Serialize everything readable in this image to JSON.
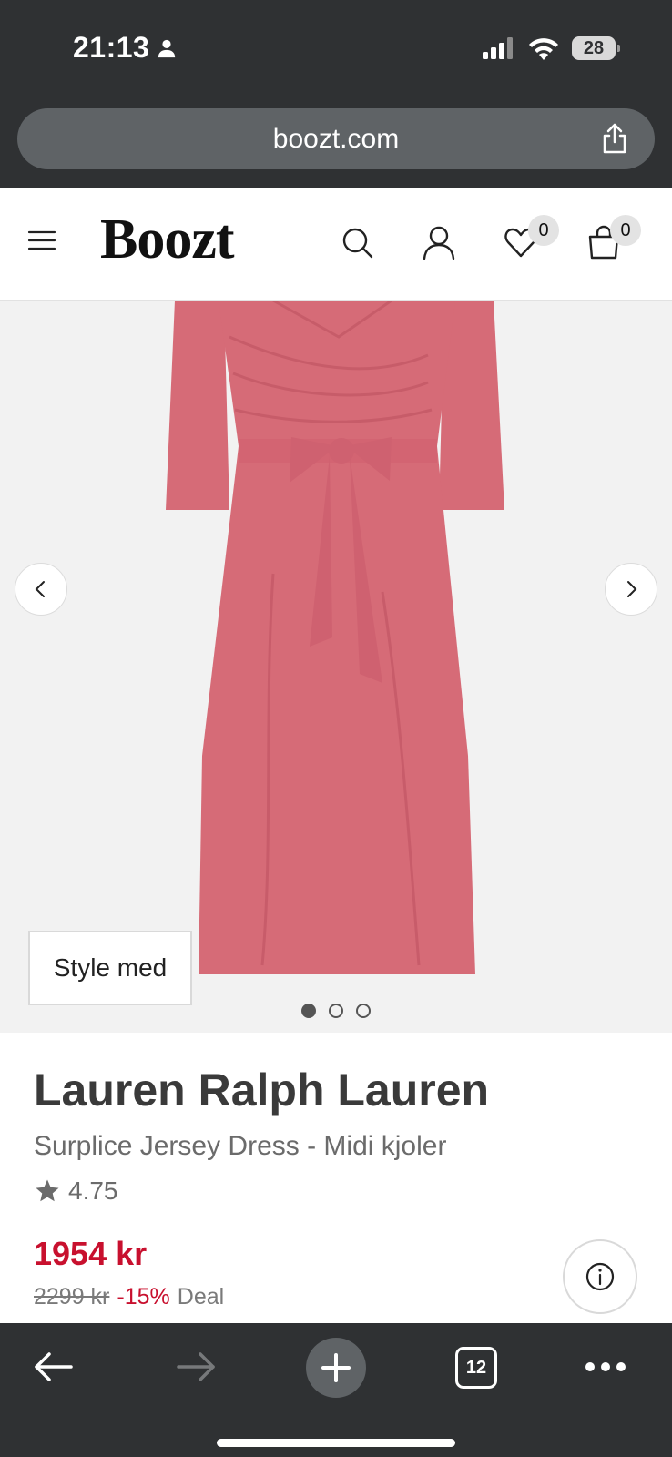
{
  "status_bar": {
    "time": "21:13",
    "battery": "28"
  },
  "browser": {
    "url": "boozt.com",
    "open_tabs": "12"
  },
  "header": {
    "logo": "Boozt",
    "wishlist_count": "0",
    "cart_count": "0"
  },
  "gallery": {
    "style_button_label": "Style med",
    "image_count": 3,
    "active_image": 1,
    "dress_color": "#d66b77"
  },
  "product": {
    "brand": "Lauren Ralph Lauren",
    "name": "Surplice Jersey Dress - Midi kjoler",
    "rating": "4.75",
    "price": "1954 kr",
    "original_price": "2299 kr",
    "discount": "-15%",
    "deal_label": "Deal"
  },
  "colors": {
    "accent_red": "#c8102e",
    "chrome_dark": "#2f3133"
  }
}
